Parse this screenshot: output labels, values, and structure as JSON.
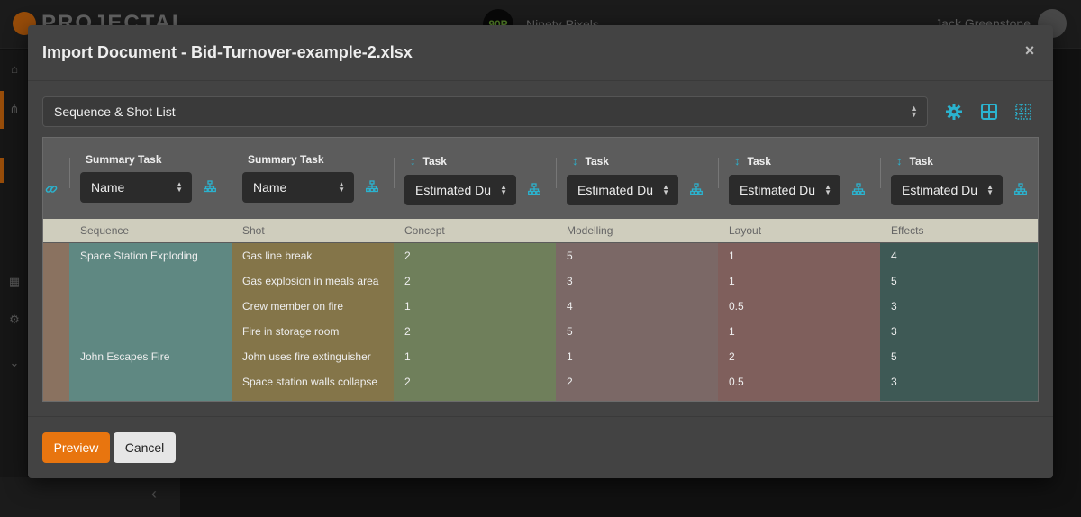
{
  "app": {
    "brand": "PROJECTAL",
    "project_initials": "90P",
    "project_name": "Ninety Pixels",
    "user_name": "Jack Greenstone"
  },
  "modal": {
    "title": "Import Document - Bid-Turnover-example-2.xlsx",
    "close_label": "×",
    "sheet_select": "Sequence & Shot List",
    "tools": [
      "settings-icon",
      "grid-icon",
      "selection-grid-icon"
    ],
    "mapping": [
      {
        "label": "",
        "field": ""
      },
      {
        "label": "Summary Task",
        "field": "Name",
        "type": "summary"
      },
      {
        "label": "Summary Task",
        "field": "Name",
        "type": "summary"
      },
      {
        "label": "Task",
        "field": "Estimated Du",
        "type": "task"
      },
      {
        "label": "Task",
        "field": "Estimated Du",
        "type": "task"
      },
      {
        "label": "Task",
        "field": "Estimated Du",
        "type": "task"
      },
      {
        "label": "Task",
        "field": "Estimated Du",
        "type": "task"
      }
    ],
    "headers": [
      "",
      "Sequence",
      "Shot",
      "Concept",
      "Modelling",
      "Layout",
      "Effects"
    ],
    "rows": [
      [
        "",
        "Space Station Exploding",
        "Gas line break",
        "2",
        "5",
        "1",
        "4"
      ],
      [
        "",
        "",
        "Gas explosion in meals area",
        "2",
        "3",
        "1",
        "5"
      ],
      [
        "",
        "",
        "Crew member on fire",
        "1",
        "4",
        "0.5",
        "3"
      ],
      [
        "",
        "",
        "Fire in storage room",
        "2",
        "5",
        "1",
        "3"
      ],
      [
        "",
        "John Escapes Fire",
        "John uses fire extinguisher",
        "1",
        "1",
        "2",
        "5"
      ],
      [
        "",
        "",
        "Space station walls collapse",
        "2",
        "2",
        "0.5",
        "3"
      ],
      [
        "",
        "",
        "",
        "",
        "",
        "",
        ""
      ]
    ],
    "column_colors": [
      "#8a7260",
      "#5f8882",
      "#847549",
      "#6f7f5b",
      "#7b6866",
      "#7f5f5c",
      "#3e5955"
    ],
    "buttons": {
      "preview": "Preview",
      "cancel": "Cancel"
    }
  },
  "colors": {
    "accent": "#e8750f",
    "icon_accent": "#2bb3cf"
  }
}
